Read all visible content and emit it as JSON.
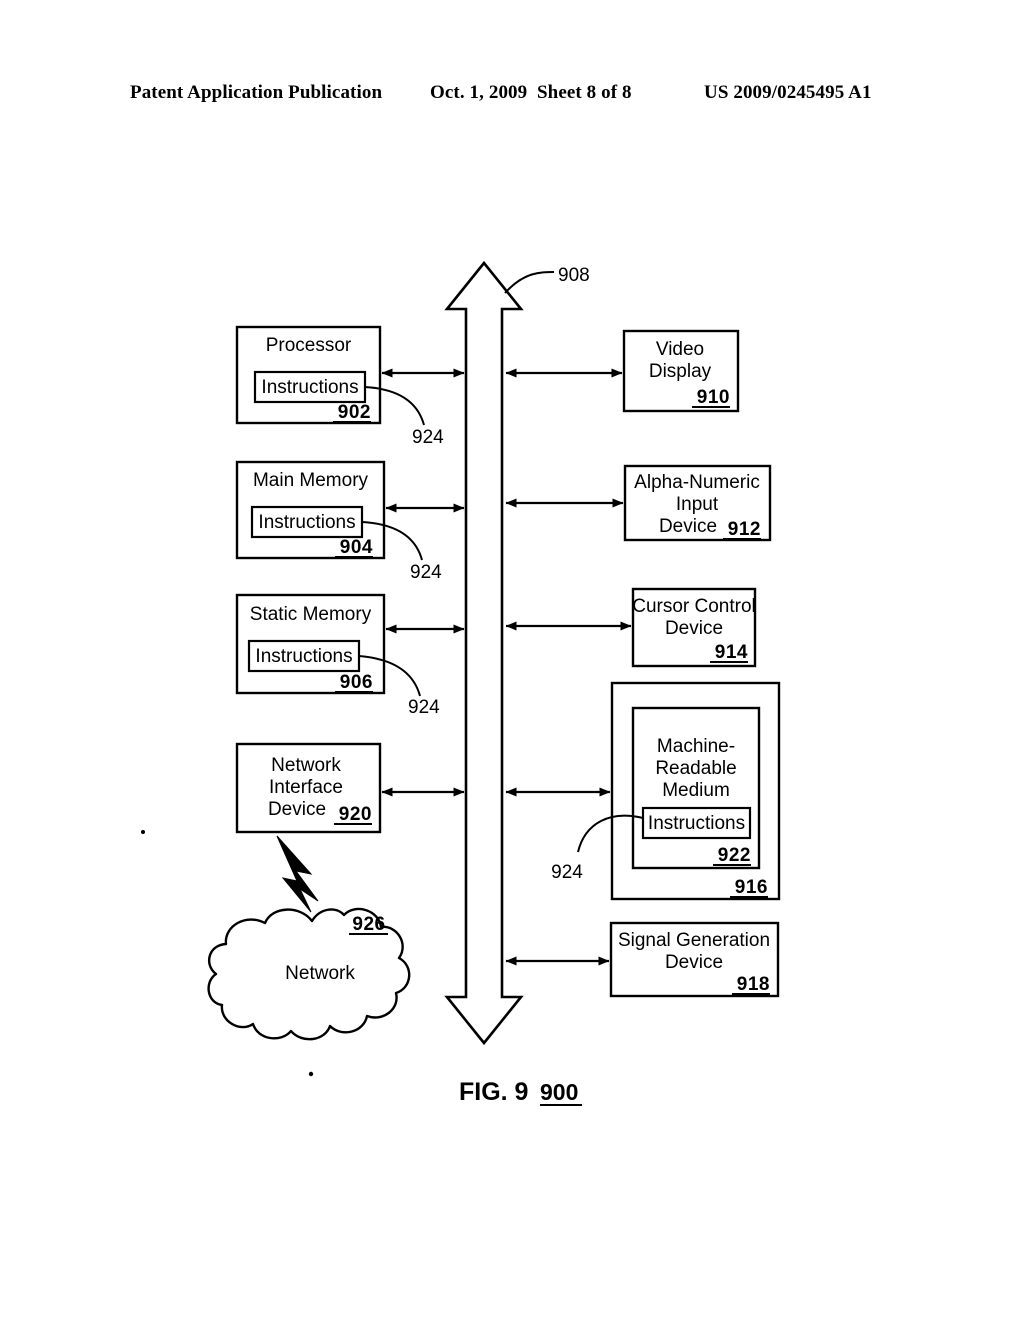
{
  "header": {
    "publication": "Patent Application Publication",
    "date": "Oct. 1, 2009",
    "sheet": "Sheet 8 of 8",
    "patent_number": "US 2009/0245495 A1"
  },
  "figure": {
    "caption_label": "FIG. 9",
    "caption_ref": "900",
    "bus_ref": "908",
    "left_column": [
      {
        "title": "Processor",
        "ref": "902",
        "inner_label": "Instructions",
        "lead_ref": "924"
      },
      {
        "title": "Main Memory",
        "ref": "904",
        "inner_label": "Instructions",
        "lead_ref": "924"
      },
      {
        "title": "Static Memory",
        "ref": "906",
        "inner_label": "Instructions",
        "lead_ref": "924"
      },
      {
        "title_line1": "Network",
        "title_line2": "Interface",
        "title_line3": "Device",
        "ref": "920"
      }
    ],
    "right_column": [
      {
        "title_line1": "Video",
        "title_line2": "Display",
        "ref": "910"
      },
      {
        "title_line1": "Alpha-Numeric",
        "title_line2": "Input",
        "title_line3": "Device",
        "ref": "912"
      },
      {
        "title_line1": "Cursor Control",
        "title_line2": "Device",
        "ref": "914"
      },
      {
        "outer_ref": "916",
        "inner_ref": "922",
        "title_line1": "Machine-",
        "title_line2": "Readable",
        "title_line3": "Medium",
        "inner_label": "Instructions",
        "lead_ref": "924"
      },
      {
        "title_line1": "Signal Generation",
        "title_line2": "Device",
        "ref": "918"
      }
    ],
    "network": {
      "label": "Network",
      "ref": "926"
    }
  },
  "colors": {
    "ink": "#000000",
    "paper": "#ffffff"
  }
}
